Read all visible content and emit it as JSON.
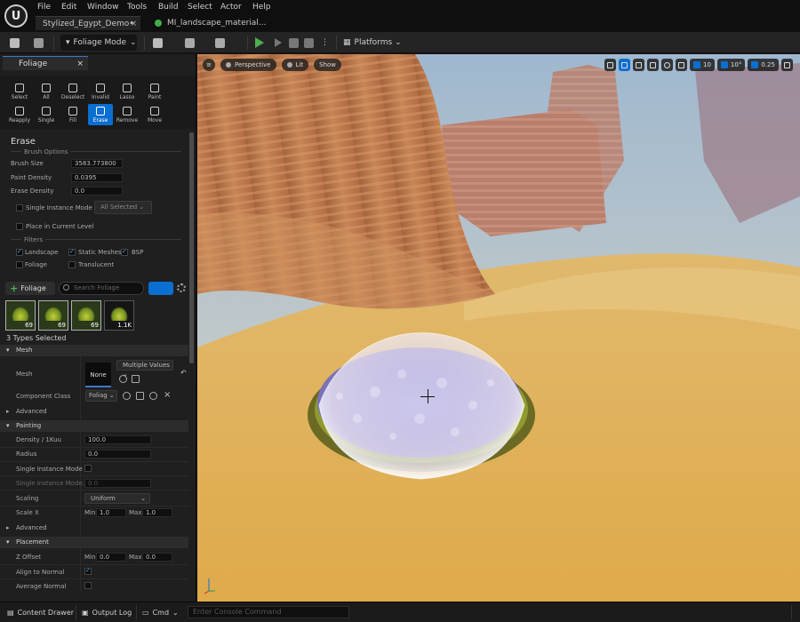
{
  "menu": {
    "items": [
      "File",
      "Edit",
      "Window",
      "Tools",
      "Build",
      "Select",
      "Actor",
      "Help"
    ]
  },
  "tabs": {
    "level": "Stylized_Egypt_Demo•",
    "material": "MI_landscape_material..."
  },
  "toolbar": {
    "mode_label": "Foliage Mode",
    "platforms_label": "Platforms"
  },
  "panel": {
    "tab_label": "Foliage",
    "tools": [
      {
        "label": "Select"
      },
      {
        "label": "All"
      },
      {
        "label": "Deselect"
      },
      {
        "label": "Invalid"
      },
      {
        "label": "Lasso"
      },
      {
        "label": "Paint"
      },
      {
        "label": "Reapply"
      },
      {
        "label": "Single"
      },
      {
        "label": "Fill"
      },
      {
        "label": "Erase"
      },
      {
        "label": "Remove"
      },
      {
        "label": "Move"
      }
    ],
    "active_tool": "Erase",
    "title": "Erase",
    "brush_options_label": "Brush Options",
    "brush_size_label": "Brush Size",
    "brush_size_value": "3583.773800",
    "paint_density_label": "Paint Density",
    "paint_density_value": "0.0395",
    "erase_density_label": "Erase Density",
    "erase_density_value": "0.0",
    "single_instance_mode_label": "Single Instance Mode",
    "all_selected_label": "All Selected",
    "place_current_level_label": "Place in Current Level",
    "filters_label": "Filters",
    "filter_landscape": "Landscape",
    "filter_static_meshes": "Static Meshes",
    "filter_bsp": "BSP",
    "filter_foliage": "Foliage",
    "filter_translucent": "Translucent",
    "add_foliage_label": "Foliage",
    "search_placeholder": "Search Foliage",
    "thumbnails": [
      {
        "count": "69"
      },
      {
        "count": "69"
      },
      {
        "count": "69"
      },
      {
        "count": "1.1K"
      }
    ],
    "types_selected": "3 Types Selected",
    "mesh_header": "Mesh",
    "mesh_label": "Mesh",
    "mesh_thumb_label": "None",
    "multiple_values_label": "Multiple Values",
    "component_class_label": "Component Class",
    "component_class_value": "Foliag",
    "advanced_label": "Advanced",
    "painting_header": "Painting",
    "density_label": "Density / 1Kuu",
    "density_value": "100.0",
    "radius_label": "Radius",
    "radius_value": "0.0",
    "single_instance_mode2_label": "Single Instance Mode",
    "single_instance_mode_ellipsis": "Single Instance Mode...",
    "single_instance_mode_ellipsis_value": "0.0",
    "scaling_label": "Scaling",
    "scaling_value": "Uniform",
    "scale_x_label": "Scale X",
    "scale_min_label": "Min",
    "scale_min_value": "1.0",
    "scale_max_label": "Max",
    "scale_max_value": "1.0",
    "advanced2_label": "Advanced",
    "placement_header": "Placement",
    "z_offset_label": "Z Offset",
    "z_min_label": "Min",
    "z_min_value": "0.0",
    "z_max_label": "Max",
    "z_max_value": "0.0",
    "align_to_normal_label": "Align to Normal",
    "average_normal_label": "Average Normal"
  },
  "viewport": {
    "perspective_label": "Perspective",
    "lit_label": "Lit",
    "show_label": "Show",
    "grid_value": "10",
    "angle_value": "10°",
    "scale_value": "0.25"
  },
  "bottom": {
    "content_drawer": "Content Drawer",
    "output_log": "Output Log",
    "cmd_label": "Cmd",
    "console_placeholder": "Enter Console Command"
  }
}
